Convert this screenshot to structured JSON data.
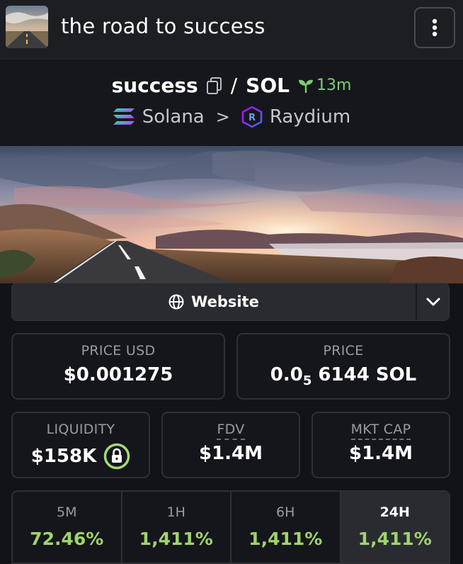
{
  "header": {
    "title": "the road to success",
    "menu_icon": "more-vertical-icon"
  },
  "pair": {
    "base": "success",
    "slash": "/",
    "quote": "SOL",
    "age": "13m",
    "chain": "Solana",
    "separator": ">",
    "dex": "Raydium"
  },
  "website": {
    "label": "Website"
  },
  "stats_row1": [
    {
      "label": "PRICE USD",
      "value": "$0.001275"
    },
    {
      "label": "PRICE",
      "value_prefix": "0.0",
      "value_sub": "5",
      "value_suffix": "6144 SOL"
    }
  ],
  "stats_row2": [
    {
      "label": "LIQUIDITY",
      "value": "$158K"
    },
    {
      "label": "FDV",
      "value": "$1.4M"
    },
    {
      "label": "MKT CAP",
      "value": "$1.4M"
    }
  ],
  "timeframes": [
    {
      "label": "5M",
      "value": "72.46%"
    },
    {
      "label": "1H",
      "value": "1,411%"
    },
    {
      "label": "6H",
      "value": "1,411%"
    },
    {
      "label": "24H",
      "value": "1,411%",
      "active": true
    }
  ],
  "colors": {
    "positive": "#9fd46c",
    "accent_green": "#7ad16b",
    "background": "#121318"
  }
}
